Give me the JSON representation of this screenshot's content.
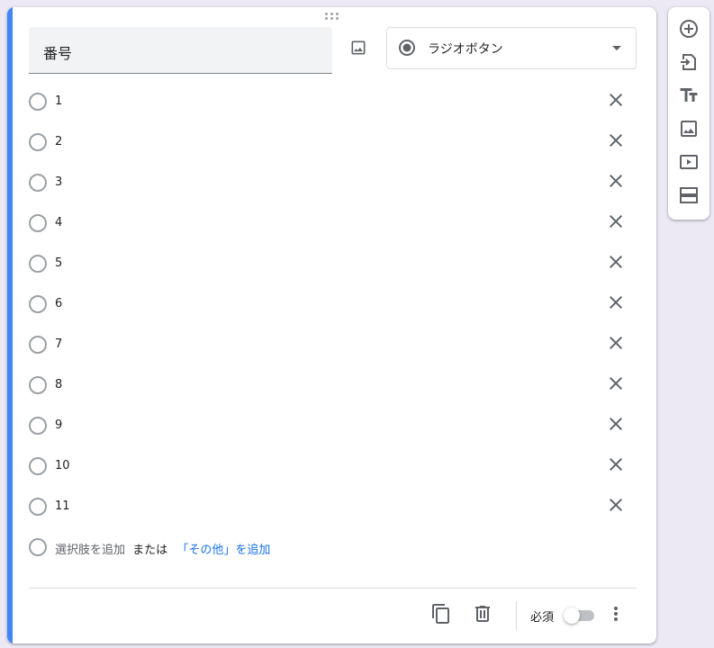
{
  "question": {
    "title": "番号"
  },
  "type_select": {
    "label": "ラジオボタン",
    "icon": "radio-button-checked-icon"
  },
  "options": [
    {
      "label": "1"
    },
    {
      "label": "2"
    },
    {
      "label": "3"
    },
    {
      "label": "4"
    },
    {
      "label": "5"
    },
    {
      "label": "6"
    },
    {
      "label": "7"
    },
    {
      "label": "8"
    },
    {
      "label": "9"
    },
    {
      "label": "10"
    },
    {
      "label": "11"
    }
  ],
  "add_option": {
    "add_label": "選択肢を追加",
    "or_label": "または",
    "other_label": "「その他」を追加"
  },
  "footer": {
    "required_label": "必須",
    "required_on": false,
    "icons": [
      "copy-icon",
      "delete-icon",
      "more-vert-icon"
    ]
  },
  "sidebar": {
    "icons": [
      "add-question-icon",
      "import-questions-icon",
      "add-title-icon",
      "add-image-icon",
      "add-video-icon",
      "add-section-icon"
    ]
  },
  "colors": {
    "accent": "#4285f4",
    "link": "#1a73e8",
    "background": "#ece9f5"
  }
}
